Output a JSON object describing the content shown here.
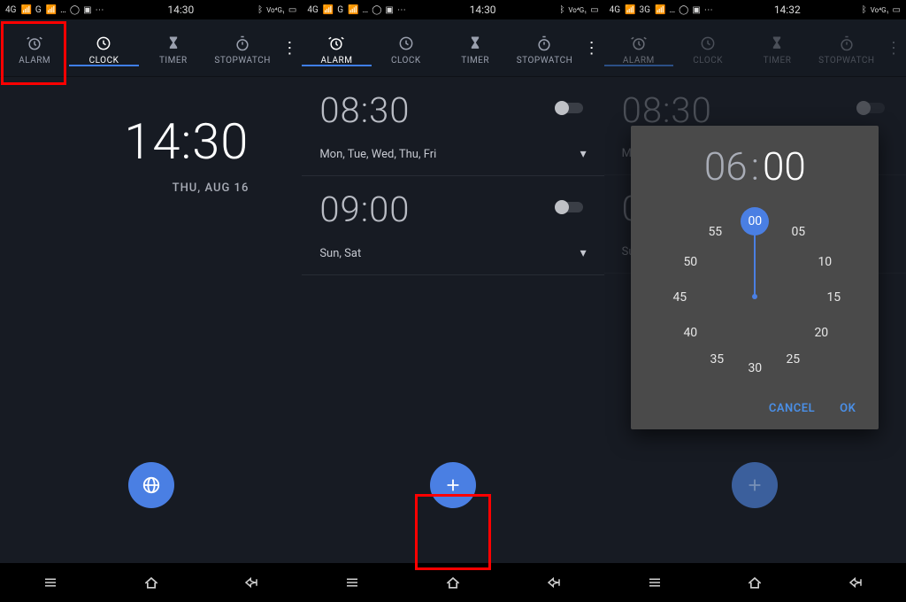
{
  "screens": {
    "s1": {
      "statusbar": {
        "time": "14:30",
        "net": "4G",
        "sig": "G"
      },
      "tabs": {
        "alarm": "ALARM",
        "clock": "CLOCK",
        "timer": "TIMER",
        "stopwatch": "STOPWATCH",
        "active": "CLOCK"
      },
      "clock": {
        "time": "14:30",
        "date": "THU, AUG 16"
      }
    },
    "s2": {
      "statusbar": {
        "time": "14:30",
        "net": "4G",
        "sig": "G"
      },
      "tabs": {
        "alarm": "ALARM",
        "clock": "CLOCK",
        "timer": "TIMER",
        "stopwatch": "STOPWATCH",
        "active": "ALARM"
      },
      "alarms": [
        {
          "time": "08:30",
          "days": "Mon, Tue, Wed, Thu, Fri",
          "on": false
        },
        {
          "time": "09:00",
          "days": "Sun, Sat",
          "on": false
        }
      ]
    },
    "s3": {
      "statusbar": {
        "time": "14:32",
        "net": "4G",
        "sig": "3G"
      },
      "tabs": {
        "alarm": "ALARM",
        "clock": "CLOCK",
        "timer": "TIMER",
        "stopwatch": "STOPWATCH",
        "active": "ALARM"
      },
      "alarms": [
        {
          "time": "08:30",
          "days_prefix": "Mo",
          "on": false
        },
        {
          "time": "0",
          "days_prefix": "Su",
          "on": false
        }
      ],
      "picker": {
        "hour": "06",
        "minute": "00",
        "face": [
          "00",
          "05",
          "10",
          "15",
          "20",
          "25",
          "30",
          "35",
          "40",
          "45",
          "50",
          "55"
        ],
        "selected": "00",
        "cancel": "CANCEL",
        "ok": "OK"
      }
    }
  },
  "icons": {
    "alarm": "alarm",
    "clock": "clock",
    "timer": "hourglass",
    "stopwatch": "stopwatch",
    "overflow": "⋮"
  }
}
